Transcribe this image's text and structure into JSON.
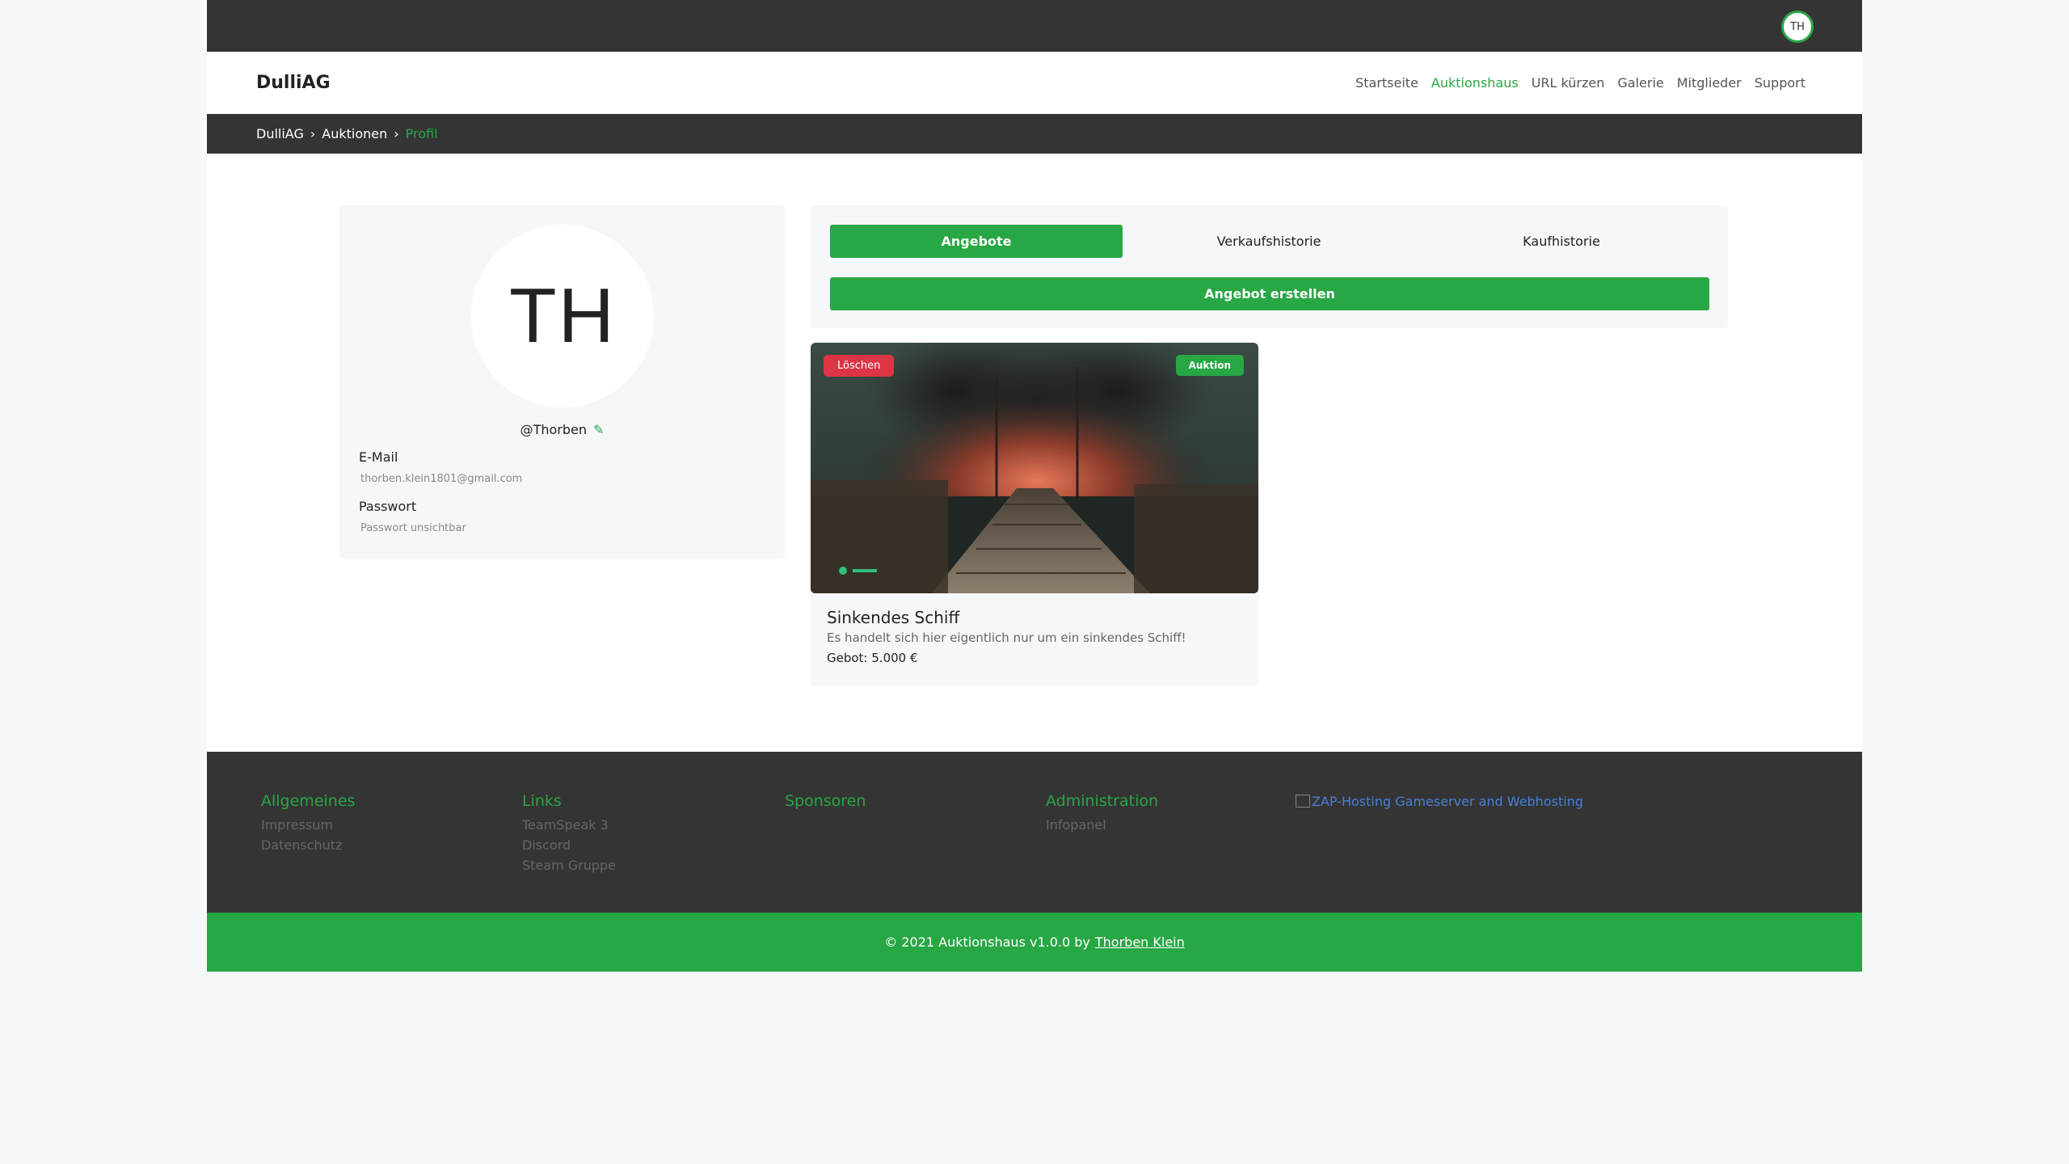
{
  "header": {
    "user_initials": "TH"
  },
  "nav": {
    "brand": "DulliAG",
    "links": [
      "Startseite",
      "Auktionshaus",
      "URL kürzen",
      "Galerie",
      "Mitglieder",
      "Support"
    ],
    "active": "Auktionshaus"
  },
  "breadcrumb": {
    "items": [
      "DulliAG",
      "Auktionen"
    ],
    "current": "Profil",
    "separator": "›"
  },
  "profile": {
    "initials": "TH",
    "username": "@Thorben",
    "email_label": "E-Mail",
    "email_value": "thorben.klein1801@gmail.com",
    "password_label": "Passwort",
    "password_value": "Passwort unsichtbar"
  },
  "tabs": {
    "items": [
      "Angebote",
      "Verkaufshistorie",
      "Kaufhistorie"
    ],
    "active": "Angebote",
    "create_label": "Angebot erstellen"
  },
  "offer": {
    "delete_label": "Löschen",
    "type_badge": "Auktion",
    "title": "Sinkendes Schiff",
    "description": "Es handelt sich hier eigentlich nur um ein sinkendes Schiff!",
    "bid": "Gebot: 5.000 €"
  },
  "footer": {
    "columns": [
      {
        "title": "Allgemeines",
        "links": [
          "Impressum",
          "Datenschutz"
        ]
      },
      {
        "title": "Links",
        "links": [
          "TeamSpeak 3",
          "Discord",
          "Steam Gruppe"
        ]
      },
      {
        "title": "Sponsoren",
        "links": []
      },
      {
        "title": "Administration",
        "links": [
          "Infopanel"
        ]
      }
    ],
    "sponsor_alt": "ZAP-Hosting Gameserver and Webhosting",
    "copyright": "© 2021 Auktionshaus v1.0.0 by",
    "author": "Thorben Klein"
  },
  "colors": {
    "accent": "#28a745",
    "danger": "#dc3545",
    "dark": "#343434"
  }
}
